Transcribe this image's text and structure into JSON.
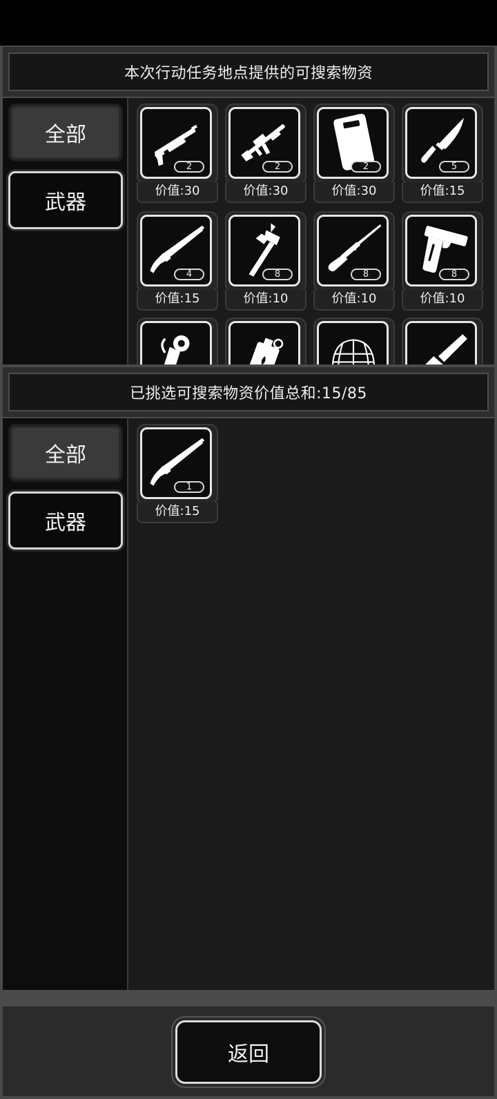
{
  "top_section": {
    "title": "本次行动任务地点提供的可搜索物资",
    "categories": [
      {
        "label": "全部",
        "active": true
      },
      {
        "label": "武器",
        "active": false
      }
    ],
    "items": [
      {
        "icon": "shotgun-icon",
        "count": "2",
        "price": "价值:30"
      },
      {
        "icon": "assault-rifle-icon",
        "count": "2",
        "price": "价值:30"
      },
      {
        "icon": "riot-shield-icon",
        "count": "2",
        "price": "价值:30"
      },
      {
        "icon": "combat-knife-icon",
        "count": "5",
        "price": "价值:15"
      },
      {
        "icon": "sawed-off-shotgun-icon",
        "count": "4",
        "price": "价值:15"
      },
      {
        "icon": "fire-axe-icon",
        "count": "8",
        "price": "价值:10"
      },
      {
        "icon": "bolt-action-rifle-icon",
        "count": "8",
        "price": "价值:10"
      },
      {
        "icon": "pistol-icon",
        "count": "8",
        "price": "价值:10"
      },
      {
        "icon": "grenade-icon",
        "count": "",
        "price": ""
      },
      {
        "icon": "molotov-can-icon",
        "count": "",
        "price": ""
      },
      {
        "icon": "helmet-net-icon",
        "count": "",
        "price": ""
      },
      {
        "icon": "chainsaw-icon",
        "count": "",
        "price": ""
      }
    ]
  },
  "bottom_section": {
    "title": "已挑选可搜索物资价值总和:15/85",
    "categories": [
      {
        "label": "全部",
        "active": true
      },
      {
        "label": "武器",
        "active": false
      }
    ],
    "items": [
      {
        "icon": "sawed-off-shotgun-icon",
        "count": "1",
        "price": "价值:15"
      }
    ]
  },
  "footer": {
    "back_label": "返回"
  },
  "colors": {
    "background": "#000000",
    "panel": "#1b1b1b",
    "sidebar": "#0d0d0d",
    "frame_border": "#e6e6e6"
  }
}
